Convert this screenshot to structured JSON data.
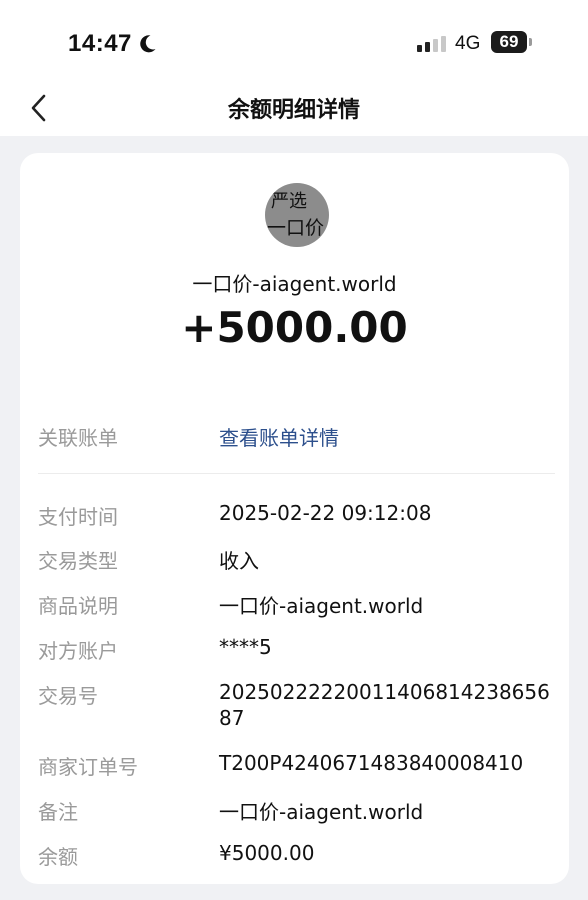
{
  "status_bar": {
    "time": "14:47",
    "network": "4G",
    "battery": "69"
  },
  "nav": {
    "title": "余额明细详情"
  },
  "merchant": {
    "avatar_line1": "严选",
    "avatar_line2": "一口价",
    "name": "一口价-aiagent.world",
    "amount": "+5000.00"
  },
  "related_bill": {
    "label": "关联账单",
    "link_text": "查看账单详情"
  },
  "details": [
    {
      "label": "支付时间",
      "value": "2025-02-22 09:12:08"
    },
    {
      "label": "交易类型",
      "value": "收入"
    },
    {
      "label": "商品说明",
      "value": "一口价-aiagent.world"
    },
    {
      "label": "对方账户",
      "value": "****5"
    },
    {
      "label": "交易号",
      "value": "2025022222001140681423865687"
    },
    {
      "label": "商家订单号",
      "value": "T200P4240671483840008410"
    },
    {
      "label": "备注",
      "value": "一口价-aiagent.world"
    },
    {
      "label": "余额",
      "value": "¥5000.00"
    }
  ],
  "colors": {
    "page_background": "#f0f1f4",
    "card_background": "#ffffff",
    "label_gray": "#9a9a9a",
    "link_blue": "#2c4f8c"
  },
  "icons": {
    "back": "chevron-left-icon",
    "moon": "moon-icon",
    "signal": "signal-bars-icon"
  }
}
